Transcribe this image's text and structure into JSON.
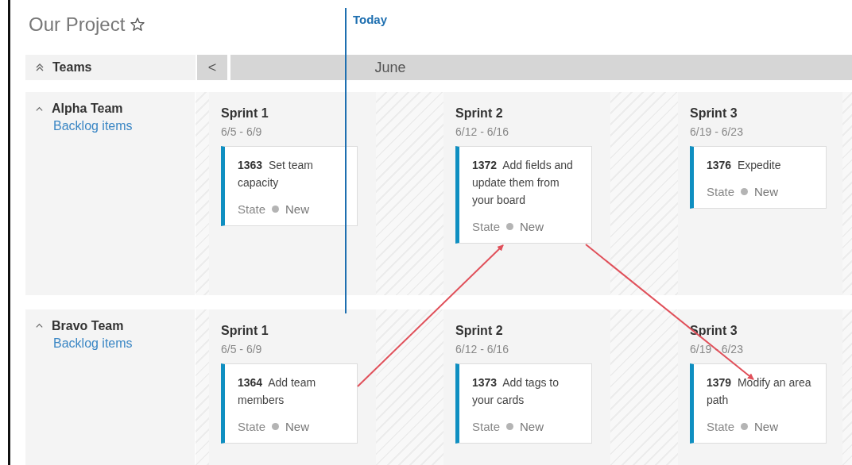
{
  "project": {
    "title": "Our Project",
    "favorite": false
  },
  "today": {
    "label": "Today"
  },
  "teams_header": {
    "label": "Teams",
    "expanded": true
  },
  "timeline": {
    "back_label": "<",
    "month": "June"
  },
  "teams": [
    {
      "name": "Alpha Team",
      "expanded": true,
      "link": "Backlog items",
      "sprints": [
        {
          "name": "Sprint 1",
          "dates": "6/5 - 6/9",
          "cards": [
            {
              "id": "1363",
              "title": "Set team capacity",
              "state_label": "State",
              "state": "New",
              "color": "#b4b4b4"
            }
          ]
        },
        {
          "name": "Sprint 2",
          "dates": "6/12 - 6/16",
          "cards": [
            {
              "id": "1372",
              "title": "Add fields and update them from your board",
              "state_label": "State",
              "state": "New",
              "color": "#b4b4b4"
            }
          ]
        },
        {
          "name": "Sprint 3",
          "dates": "6/19 - 6/23",
          "cards": [
            {
              "id": "1376",
              "title": "Expedite",
              "state_label": "State",
              "state": "New",
              "color": "#b4b4b4"
            }
          ]
        }
      ]
    },
    {
      "name": "Bravo Team",
      "expanded": true,
      "link": "Backlog items",
      "sprints": [
        {
          "name": "Sprint 1",
          "dates": "6/5 - 6/9",
          "cards": [
            {
              "id": "1364",
              "title": "Add team members",
              "state_label": "State",
              "state": "New",
              "color": "#b4b4b4"
            }
          ]
        },
        {
          "name": "Sprint 2",
          "dates": "6/12 - 6/16",
          "cards": [
            {
              "id": "1373",
              "title": "Add tags to your cards",
              "state_label": "State",
              "state": "New",
              "color": "#b4b4b4"
            }
          ]
        },
        {
          "name": "Sprint 3",
          "dates": "6/19 - 6/23",
          "cards": [
            {
              "id": "1379",
              "title": "Modify an area path",
              "state_label": "State",
              "state": "New",
              "color": "#b4b4b4"
            }
          ]
        }
      ]
    }
  ]
}
